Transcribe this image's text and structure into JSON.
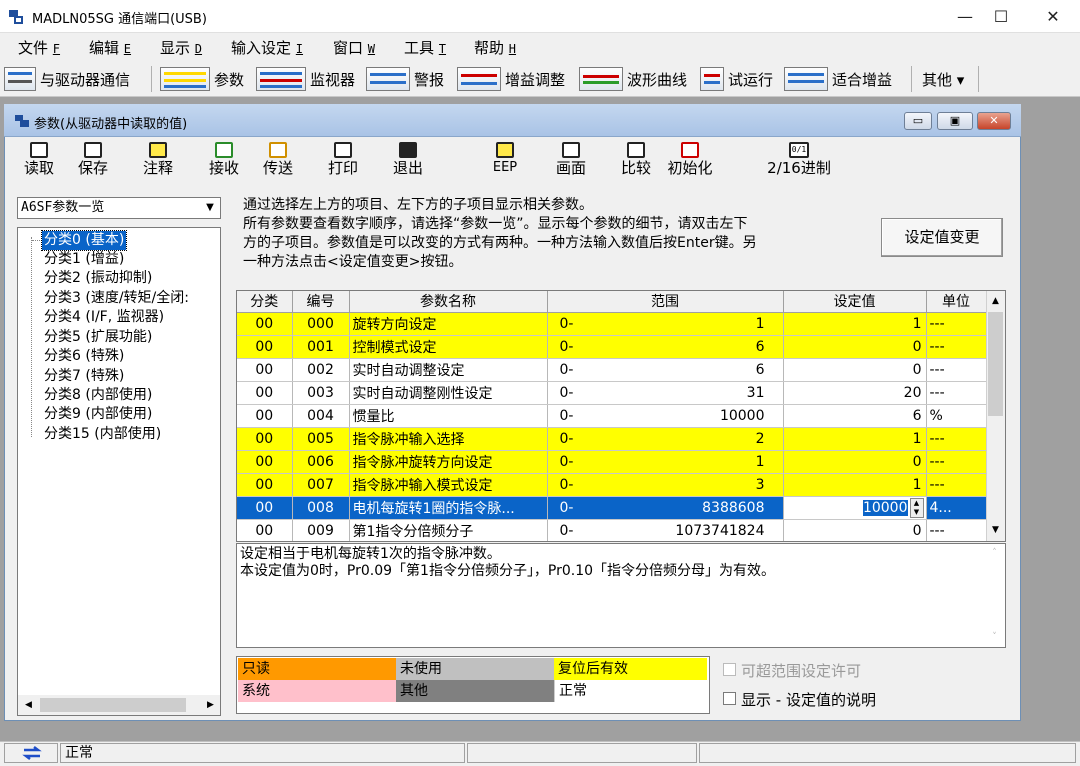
{
  "window": {
    "title": "MADLN05SG  通信端口(USB)",
    "minimize": "—",
    "maximize": "☐",
    "close": "✕"
  },
  "menu": [
    {
      "label": "文件",
      "key": "F"
    },
    {
      "label": "编辑",
      "key": "E"
    },
    {
      "label": "显示",
      "key": "D"
    },
    {
      "label": "输入设定",
      "key": "I"
    },
    {
      "label": "窗口",
      "key": "W"
    },
    {
      "label": "工具",
      "key": "T"
    },
    {
      "label": "帮助",
      "key": "H"
    }
  ],
  "toolbar": {
    "connect": "与驱动器通信",
    "params": "参数",
    "monitor": "监视器",
    "alarm": "警报",
    "gain": "增益调整",
    "waveform": "波形曲线",
    "trial": "试运行",
    "fit_gain": "适合增益",
    "other": "其他 ▾"
  },
  "child_window": {
    "title": "参数(从驱动器中读取的值)",
    "buttons": {
      "read": "读取",
      "save": "保存",
      "comment": "注释",
      "receive": "接收",
      "send": "传送",
      "print": "打印",
      "exit": "退出",
      "eep": "EEP",
      "screen": "画面",
      "compare": "比较",
      "init": "初始化",
      "hex": "2/16进制",
      "hex_icon": "0/1"
    }
  },
  "tree": {
    "selected_list": "A6SF参数一览",
    "items": [
      "分类0 (基本)",
      "分类1 (增益)",
      "分类2 (振动抑制)",
      "分类3 (速度/转矩/全闭:",
      "分类4 (I/F, 监视器)",
      "分类5 (扩展功能)",
      "分类6 (特殊)",
      "分类7 (特殊)",
      "分类8 (内部使用)",
      "分类9 (内部使用)",
      "分类15 (内部使用)"
    ]
  },
  "info": {
    "line1": "通过选择左上方的项目、左下方的子项目显示相关参数。",
    "line2": "所有参数要查看数字顺序，请选择“参数一览”。显示每个参数的细节，请双击左下",
    "line3": "方的子项目。参数值是可以改变的方式有两种。一种方法输入数值后按Enter键。另",
    "line4": "一种方法点击<设定值变更>按钮。",
    "change_button": "设定值变更"
  },
  "table": {
    "headers": [
      "分类",
      "编号",
      "参数名称",
      "范围",
      "设定值",
      "单位"
    ],
    "rows": [
      {
        "cat": "00",
        "no": "000",
        "name": "旋转方向设定",
        "min": "0-",
        "max": "1",
        "value": "1",
        "unit": "---",
        "style": "yellow"
      },
      {
        "cat": "00",
        "no": "001",
        "name": "控制模式设定",
        "min": "0-",
        "max": "6",
        "value": "0",
        "unit": "---",
        "style": "yellow"
      },
      {
        "cat": "00",
        "no": "002",
        "name": "实时自动调整设定",
        "min": "0-",
        "max": "6",
        "value": "0",
        "unit": "---",
        "style": "white"
      },
      {
        "cat": "00",
        "no": "003",
        "name": "实时自动调整刚性设定",
        "min": "0-",
        "max": "31",
        "value": "20",
        "unit": "---",
        "style": "white"
      },
      {
        "cat": "00",
        "no": "004",
        "name": "惯量比",
        "min": "0-",
        "max": "10000",
        "value": "6",
        "unit": "%",
        "style": "white"
      },
      {
        "cat": "00",
        "no": "005",
        "name": "指令脉冲输入选择",
        "min": "0-",
        "max": "2",
        "value": "1",
        "unit": "---",
        "style": "yellow"
      },
      {
        "cat": "00",
        "no": "006",
        "name": "指令脉冲旋转方向设定",
        "min": "0-",
        "max": "1",
        "value": "0",
        "unit": "---",
        "style": "yellow"
      },
      {
        "cat": "00",
        "no": "007",
        "name": "指令脉冲输入模式设定",
        "min": "0-",
        "max": "3",
        "value": "1",
        "unit": "---",
        "style": "yellow"
      },
      {
        "cat": "00",
        "no": "008",
        "name": "电机每旋转1圈的指令脉...",
        "min": "0-",
        "max": "8388608",
        "value": "10000",
        "unit": "4...",
        "style": "sel"
      },
      {
        "cat": "00",
        "no": "009",
        "name": "第1指令分倍频分子",
        "min": "0-",
        "max": "1073741824",
        "value": "0",
        "unit": "---",
        "style": "white"
      }
    ]
  },
  "description": {
    "line1": "设定相当于电机每旋转1次的指令脉冲数。",
    "line2": "本设定值为0时，Pr0.09「第1指令分倍频分子」，Pr0.10「指令分倍频分母」为有效。"
  },
  "legend": {
    "readonly": "只读",
    "unused": "未使用",
    "reset_effective": "复位后有效",
    "system": "系统",
    "other": "其他",
    "normal": "正常",
    "colors": {
      "readonly": "#ff9900",
      "unused": "#c0c0c0",
      "reset_effective": "#ffff00",
      "system": "#ffc0cb",
      "other": "#808080",
      "normal": "#ffffff"
    }
  },
  "options": {
    "allow_out_of_range": "可超范围设定许可",
    "show_description": "显示 - 设定值的说明"
  },
  "status": {
    "text": "正常"
  }
}
